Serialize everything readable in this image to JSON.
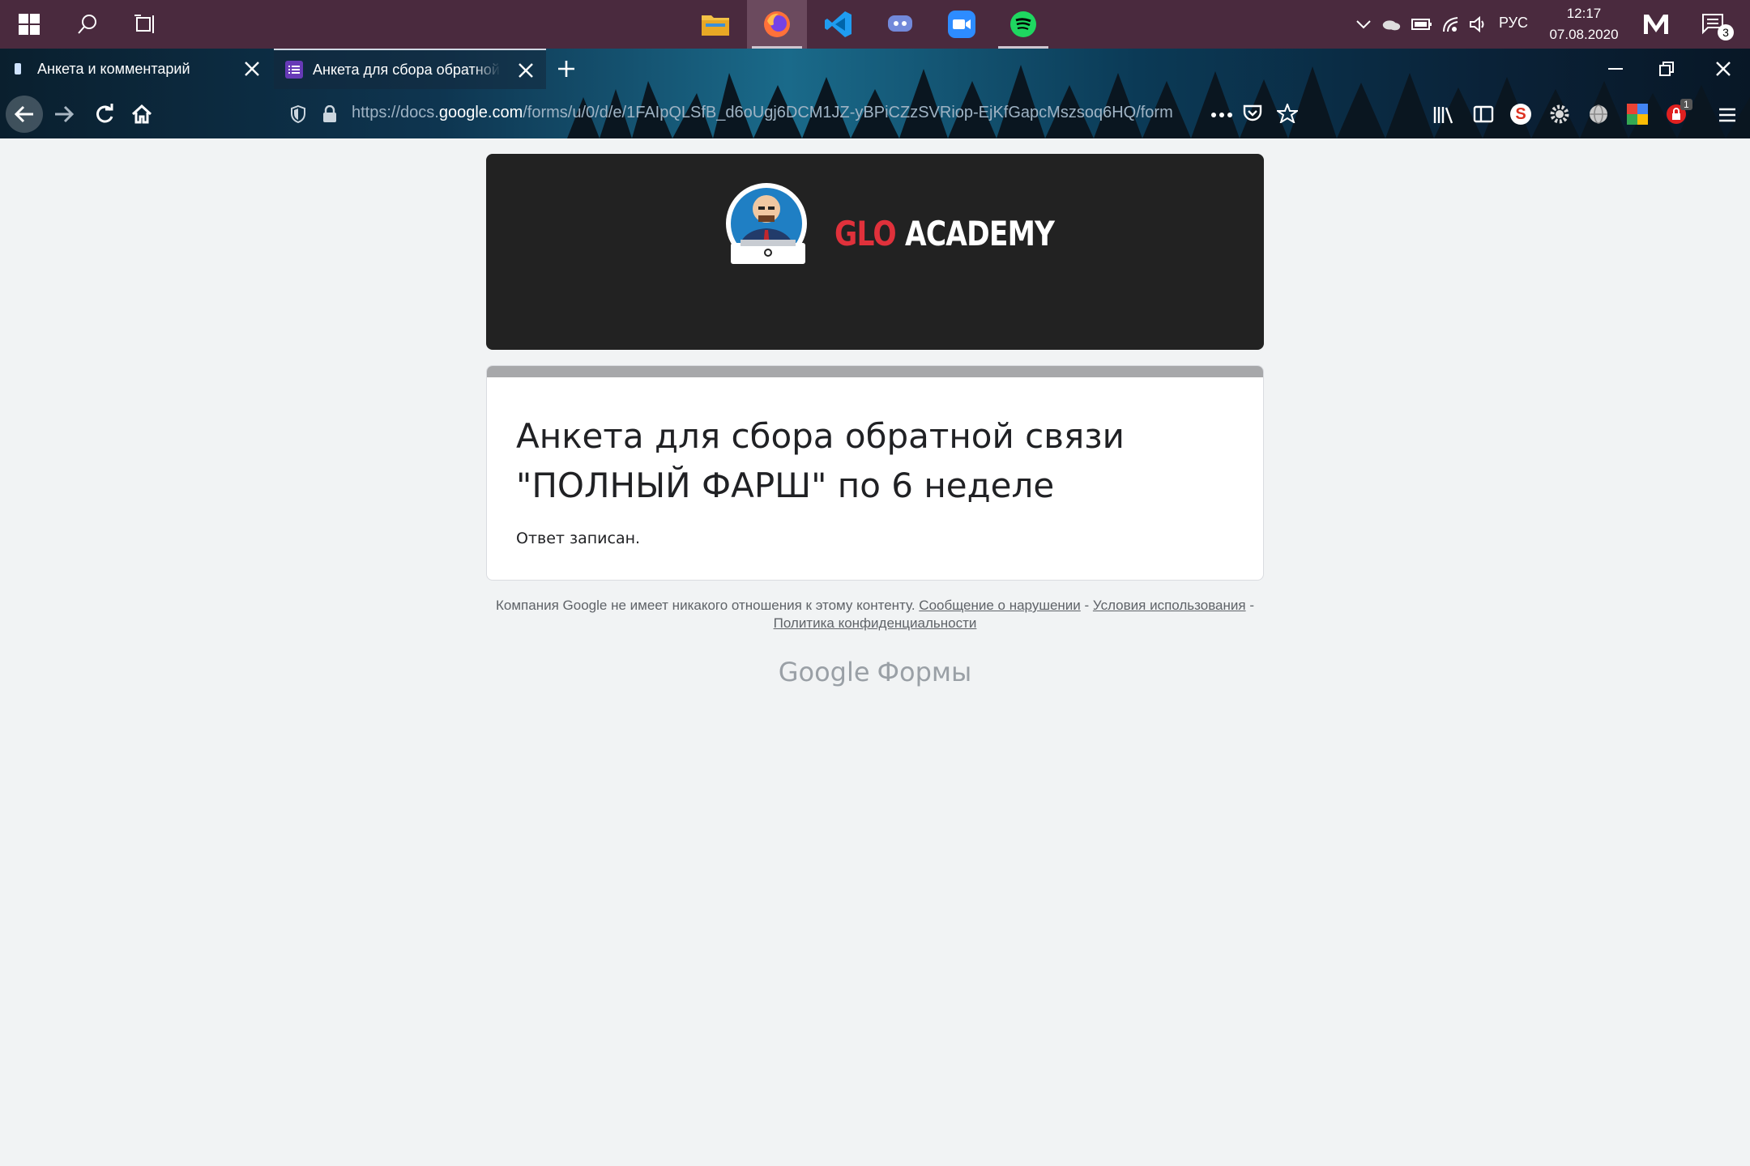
{
  "taskbar": {
    "pinned_apps": [
      {
        "name": "File Explorer",
        "icon": "folder-icon"
      },
      {
        "name": "Firefox",
        "icon": "firefox-icon"
      },
      {
        "name": "Visual Studio Code",
        "icon": "vscode-icon"
      },
      {
        "name": "Discord",
        "icon": "discord-icon"
      },
      {
        "name": "Zoom",
        "icon": "zoom-icon"
      },
      {
        "name": "Spotify",
        "icon": "spotify-icon"
      }
    ],
    "language": "РУС",
    "time": "12:17",
    "date": "07.08.2020",
    "notification_count": "3"
  },
  "browser": {
    "tabs": [
      {
        "title": "Анкета и комментарий",
        "selected": false
      },
      {
        "title": "Анкета для сбора обратной связи",
        "selected": true
      }
    ],
    "url": {
      "prefix": "https://docs.",
      "domain": "google.com",
      "path": "/forms/u/0/d/e/1FAIpQLSfB_d6oUgj6DCM1JZ-yBPiCZzSVRiop-EjKfGapcMszsoq6HQ/form"
    },
    "extension_badge": "1"
  },
  "form": {
    "banner_brand_red": "GLO",
    "banner_brand_white": "ACADEMY",
    "title": "Анкета для сбора обратной связи \"ПОЛНЫЙ ФАРШ\" по 6 неделе",
    "confirmation": "Ответ записан.",
    "accent_color": "#a7a8aa"
  },
  "footer": {
    "disclaimer": "Компания Google не имеет никакого отношения к этому контенту.",
    "report_link": "Сообщение о нарушении",
    "sep1": " - ",
    "terms_link": "Условия использования",
    "sep2": " - ",
    "privacy_link": "Политика конфиденциальности",
    "brand_google": "Google",
    "brand_product": "Формы"
  }
}
